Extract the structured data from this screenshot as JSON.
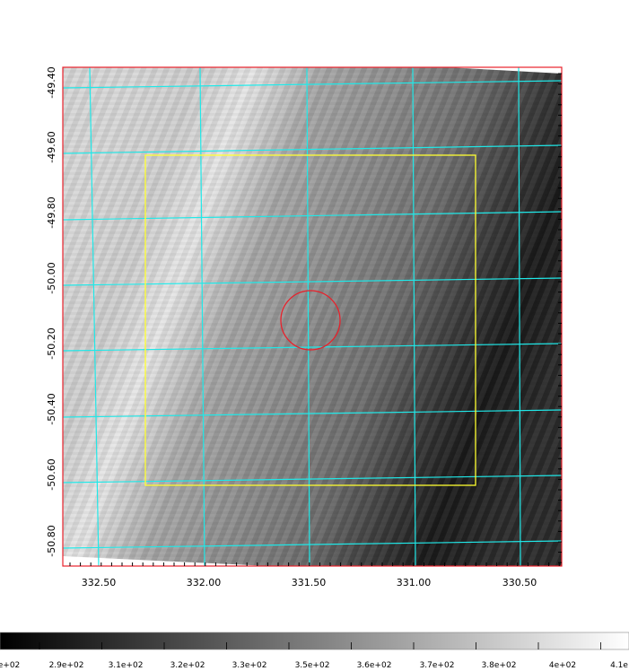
{
  "x_labels": [
    "332.50",
    "332.00",
    "331.50",
    "331.00",
    "330.50"
  ],
  "y_labels": [
    "-49.40",
    "-49.60",
    "-49.80",
    "-50.00",
    "-50.20",
    "-50.40",
    "-50.60",
    "-50.80"
  ],
  "colorbar_labels": [
    "e+02",
    "2.9e+02",
    "3.1e+02",
    "3.2e+02",
    "3.3e+02",
    "3.5e+02",
    "3.6e+02",
    "3.7e+02",
    "3.8e+02",
    "4e+02",
    "4.1e"
  ],
  "colors": {
    "frame": "#e8212b",
    "grid": "#20e8e8",
    "box": "#ffff30",
    "circle": "#e8212b"
  }
}
